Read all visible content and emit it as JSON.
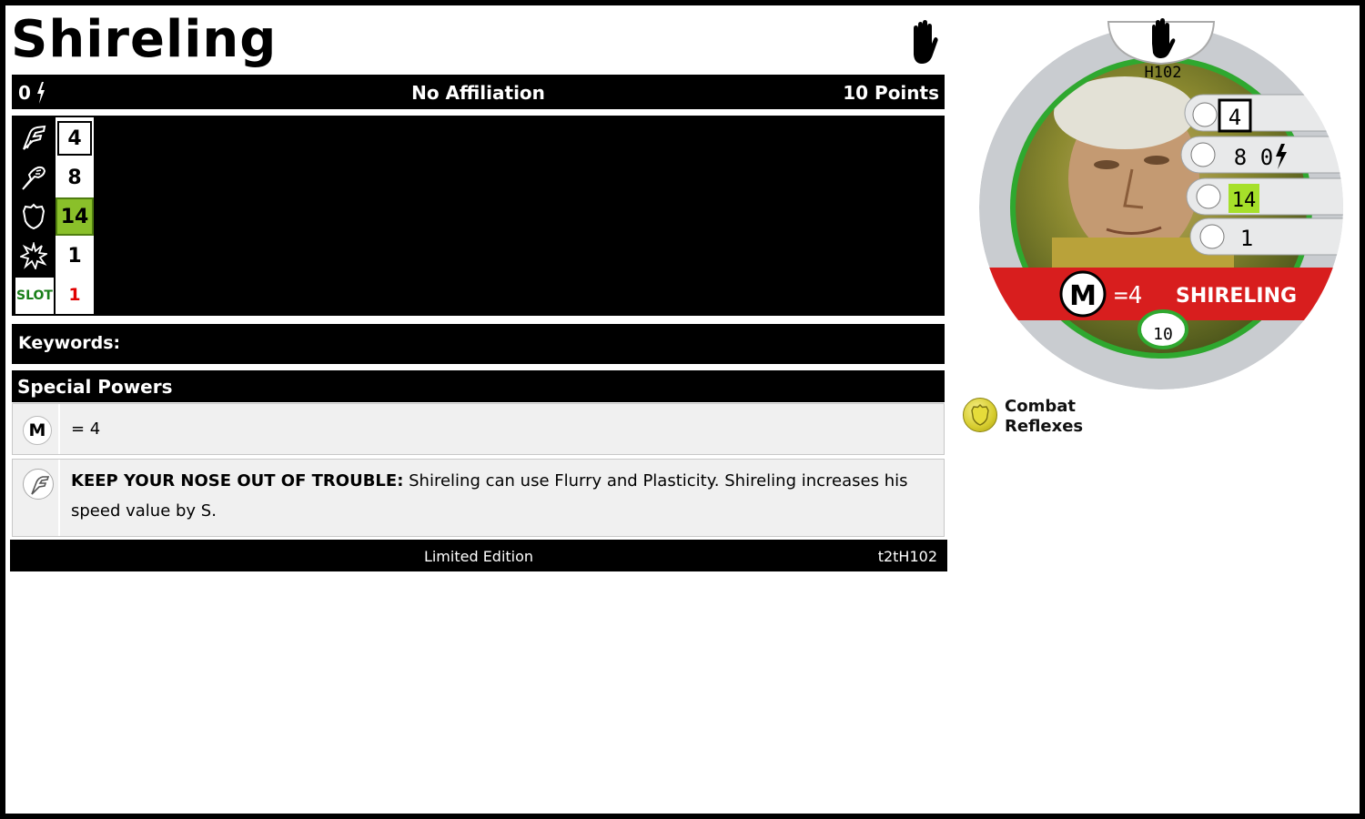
{
  "character": {
    "name": "Shireling",
    "keep_icon": "hand-icon"
  },
  "header_bar": {
    "cost_value": "0",
    "cost_icon": "lightning-bolt-icon",
    "affiliation": "No Affiliation",
    "points": "10 Points"
  },
  "stats": {
    "speed": "4",
    "attack": "8",
    "defense": "14",
    "damage": "1",
    "slot_label": "SLOT",
    "slot_value": "1",
    "icons": [
      "speed-boot-icon",
      "attack-fist-icon",
      "defense-shield-icon",
      "damage-starburst-icon"
    ],
    "defense_highlight": "#8ac02a",
    "slot_color": "#1a7f1a",
    "slot_value_color": "#e00000"
  },
  "keywords": {
    "label": "Keywords:"
  },
  "special_powers": {
    "header": "Special Powers",
    "rows": [
      {
        "badge": "M",
        "text": "= 4"
      },
      {
        "icon": "speed-boot-icon",
        "title": "KEEP YOUR NOSE OUT OF TROUBLE:",
        "text": " Shireling can use Flurry and Plasticity. Shireling increases his speed value by S."
      }
    ]
  },
  "footer": {
    "edition": "Limited Edition",
    "code": "t2tH102"
  },
  "dial": {
    "set_code": "H102",
    "speed": "4",
    "attack": "8",
    "cost": "0",
    "defense": "14",
    "damage": "1",
    "m_label": "=4",
    "name_banner": "SHIRELING",
    "points": "10",
    "banner_color": "#d81e1e",
    "ring_color": "#2fa82f"
  },
  "ability": {
    "name": "Combat Reflexes",
    "icon": "shield-badge-icon"
  }
}
